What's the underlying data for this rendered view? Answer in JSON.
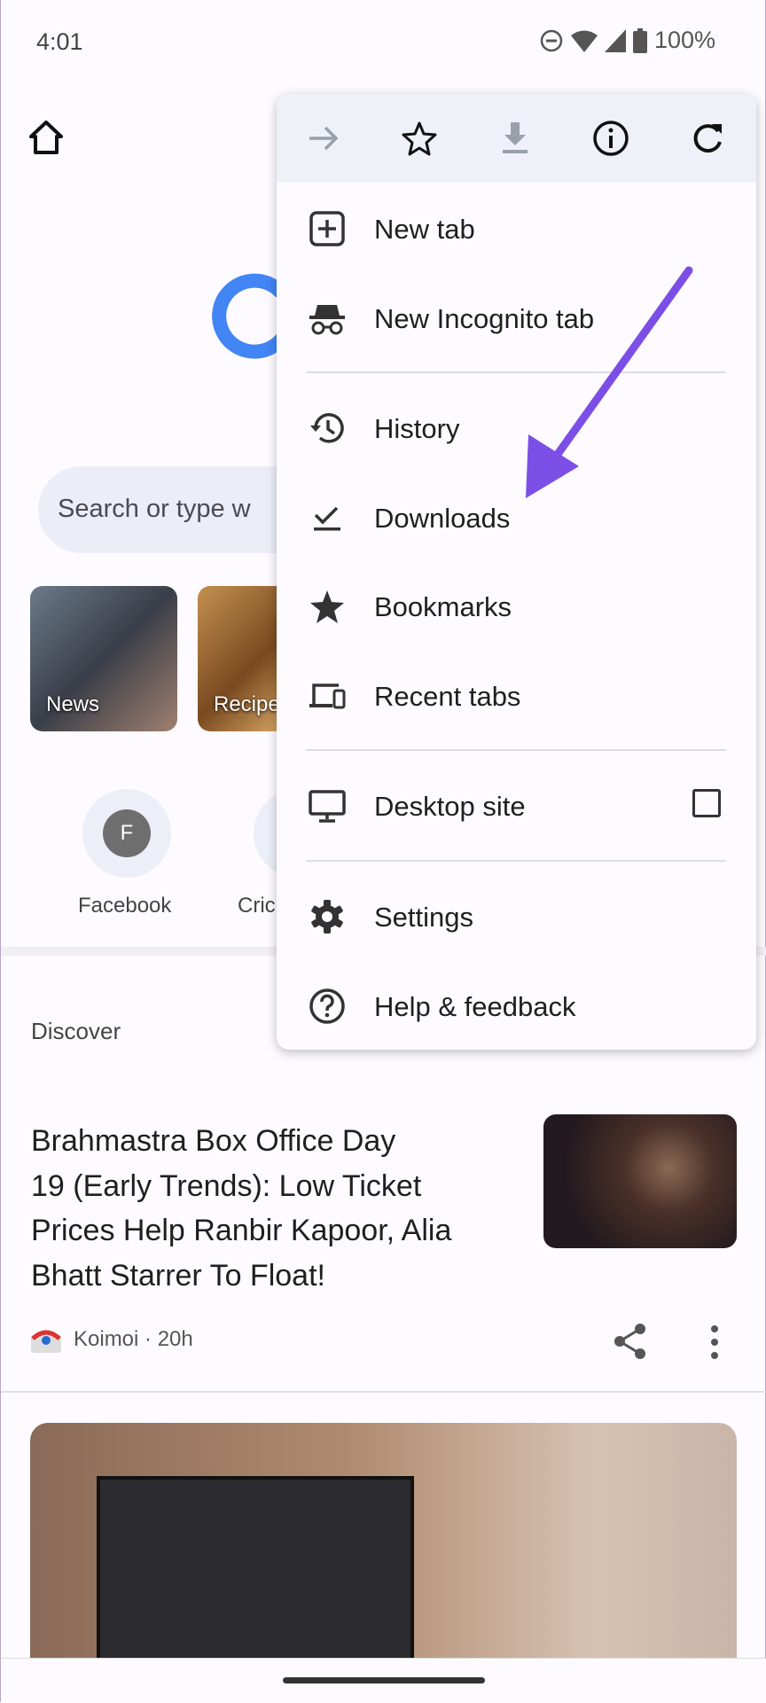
{
  "status_bar": {
    "time": "4:01",
    "battery": "100%",
    "icons": [
      "dnd-icon",
      "wifi-icon",
      "signal-icon",
      "battery-icon"
    ]
  },
  "search": {
    "placeholder": "Search or type w"
  },
  "tiles": [
    {
      "label": "News"
    },
    {
      "label": "Recipe"
    }
  ],
  "shortcuts": [
    {
      "label": "Facebook",
      "initial": "F"
    },
    {
      "label": "Cric"
    }
  ],
  "discover": {
    "heading": "Discover"
  },
  "article": {
    "title_lines": [
      "Brahmastra Box Office Day",
      "19 (Early Trends): Low Ticket",
      "Prices Help Ranbir Kapoor, Alia",
      "Bhatt Starrer To Float!"
    ],
    "source": "Koimoi · 20h"
  },
  "menu": {
    "toolbar": [
      "forward-icon",
      "bookmark-star-icon",
      "download-icon",
      "info-icon",
      "refresh-icon"
    ],
    "items": [
      {
        "label": "New tab",
        "icon": "new-tab-icon"
      },
      {
        "label": "New Incognito tab",
        "icon": "incognito-icon"
      },
      {
        "label": "History",
        "icon": "history-icon"
      },
      {
        "label": "Downloads",
        "icon": "downloads-icon"
      },
      {
        "label": "Bookmarks",
        "icon": "bookmarks-icon"
      },
      {
        "label": "Recent tabs",
        "icon": "recent-tabs-icon"
      },
      {
        "label": "Desktop site",
        "icon": "desktop-icon",
        "checked": false
      },
      {
        "label": "Settings",
        "icon": "settings-icon"
      },
      {
        "label": "Help & feedback",
        "icon": "help-icon"
      }
    ]
  },
  "colors": {
    "annotation_arrow": "#7b4fe6",
    "google_blue": "#4285f4",
    "menu_toolbar_bg": "#eff1f8"
  }
}
